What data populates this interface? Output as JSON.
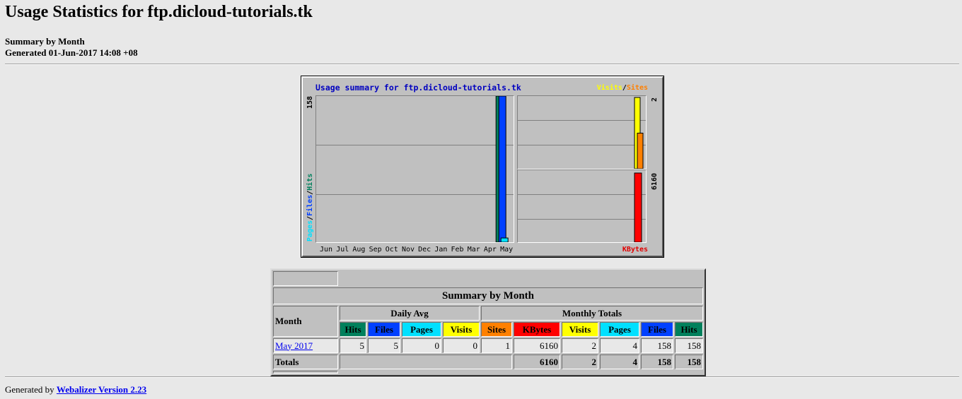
{
  "page": {
    "title": "Usage Statistics for ftp.dicloud-tutorials.tk",
    "subtitle": "Summary by Month",
    "generated": "Generated 01-Jun-2017 14:08 +08"
  },
  "graph": {
    "title": "Usage summary for ftp.dicloud-tutorials.tk",
    "legend_visits": "Visits",
    "legend_sep": "/",
    "legend_sites": "Sites",
    "left_scale_max": "158",
    "left_axis_pages": "Pages",
    "left_axis_files": "Files",
    "left_axis_hits": "Hits",
    "right_top_max": "2",
    "right_bottom_max": "6160",
    "kbytes_label": "KBytes",
    "months": [
      "Jun",
      "Jul",
      "Aug",
      "Sep",
      "Oct",
      "Nov",
      "Dec",
      "Jan",
      "Feb",
      "Mar",
      "Apr",
      "May"
    ],
    "colors": {
      "hits": "#00805c",
      "files": "#0040ff",
      "pages": "#00e0ff",
      "visits": "#ffff00",
      "sites": "#ff8000",
      "kbytes": "#ff0000"
    }
  },
  "chart_data": {
    "type": "bar",
    "title": "Usage summary for ftp.dicloud-tutorials.tk",
    "categories": [
      "Jun",
      "Jul",
      "Aug",
      "Sep",
      "Oct",
      "Nov",
      "Dec",
      "Jan",
      "Feb",
      "Mar",
      "Apr",
      "May"
    ],
    "series": [
      {
        "name": "Hits",
        "values": [
          0,
          0,
          0,
          0,
          0,
          0,
          0,
          0,
          0,
          0,
          0,
          158
        ]
      },
      {
        "name": "Files",
        "values": [
          0,
          0,
          0,
          0,
          0,
          0,
          0,
          0,
          0,
          0,
          0,
          158
        ]
      },
      {
        "name": "Pages",
        "values": [
          0,
          0,
          0,
          0,
          0,
          0,
          0,
          0,
          0,
          0,
          0,
          4
        ]
      },
      {
        "name": "Visits",
        "values": [
          0,
          0,
          0,
          0,
          0,
          0,
          0,
          0,
          0,
          0,
          0,
          2
        ]
      },
      {
        "name": "Sites",
        "values": [
          0,
          0,
          0,
          0,
          0,
          0,
          0,
          0,
          0,
          0,
          0,
          1
        ]
      },
      {
        "name": "KBytes",
        "values": [
          0,
          0,
          0,
          0,
          0,
          0,
          0,
          0,
          0,
          0,
          0,
          6160
        ]
      }
    ]
  },
  "table": {
    "caption": "Summary by Month",
    "month_header": "Month",
    "daily_avg_header": "Daily Avg",
    "monthly_totals_header": "Monthly Totals",
    "daily_cols": [
      "Hits",
      "Files",
      "Pages",
      "Visits"
    ],
    "monthly_cols": [
      "Sites",
      "KBytes",
      "Visits",
      "Pages",
      "Files",
      "Hits"
    ],
    "rows": [
      {
        "month": "May 2017",
        "daily_hits": "5",
        "daily_files": "5",
        "daily_pages": "0",
        "daily_visits": "0",
        "sites": "1",
        "kbytes": "6160",
        "visits": "2",
        "pages": "4",
        "files": "158",
        "hits": "158"
      }
    ],
    "totals": {
      "label": "Totals",
      "kbytes": "6160",
      "visits": "2",
      "pages": "4",
      "files": "158",
      "hits": "158"
    }
  },
  "footer": {
    "prefix": "Generated by ",
    "link": "Webalizer Version 2.23"
  }
}
